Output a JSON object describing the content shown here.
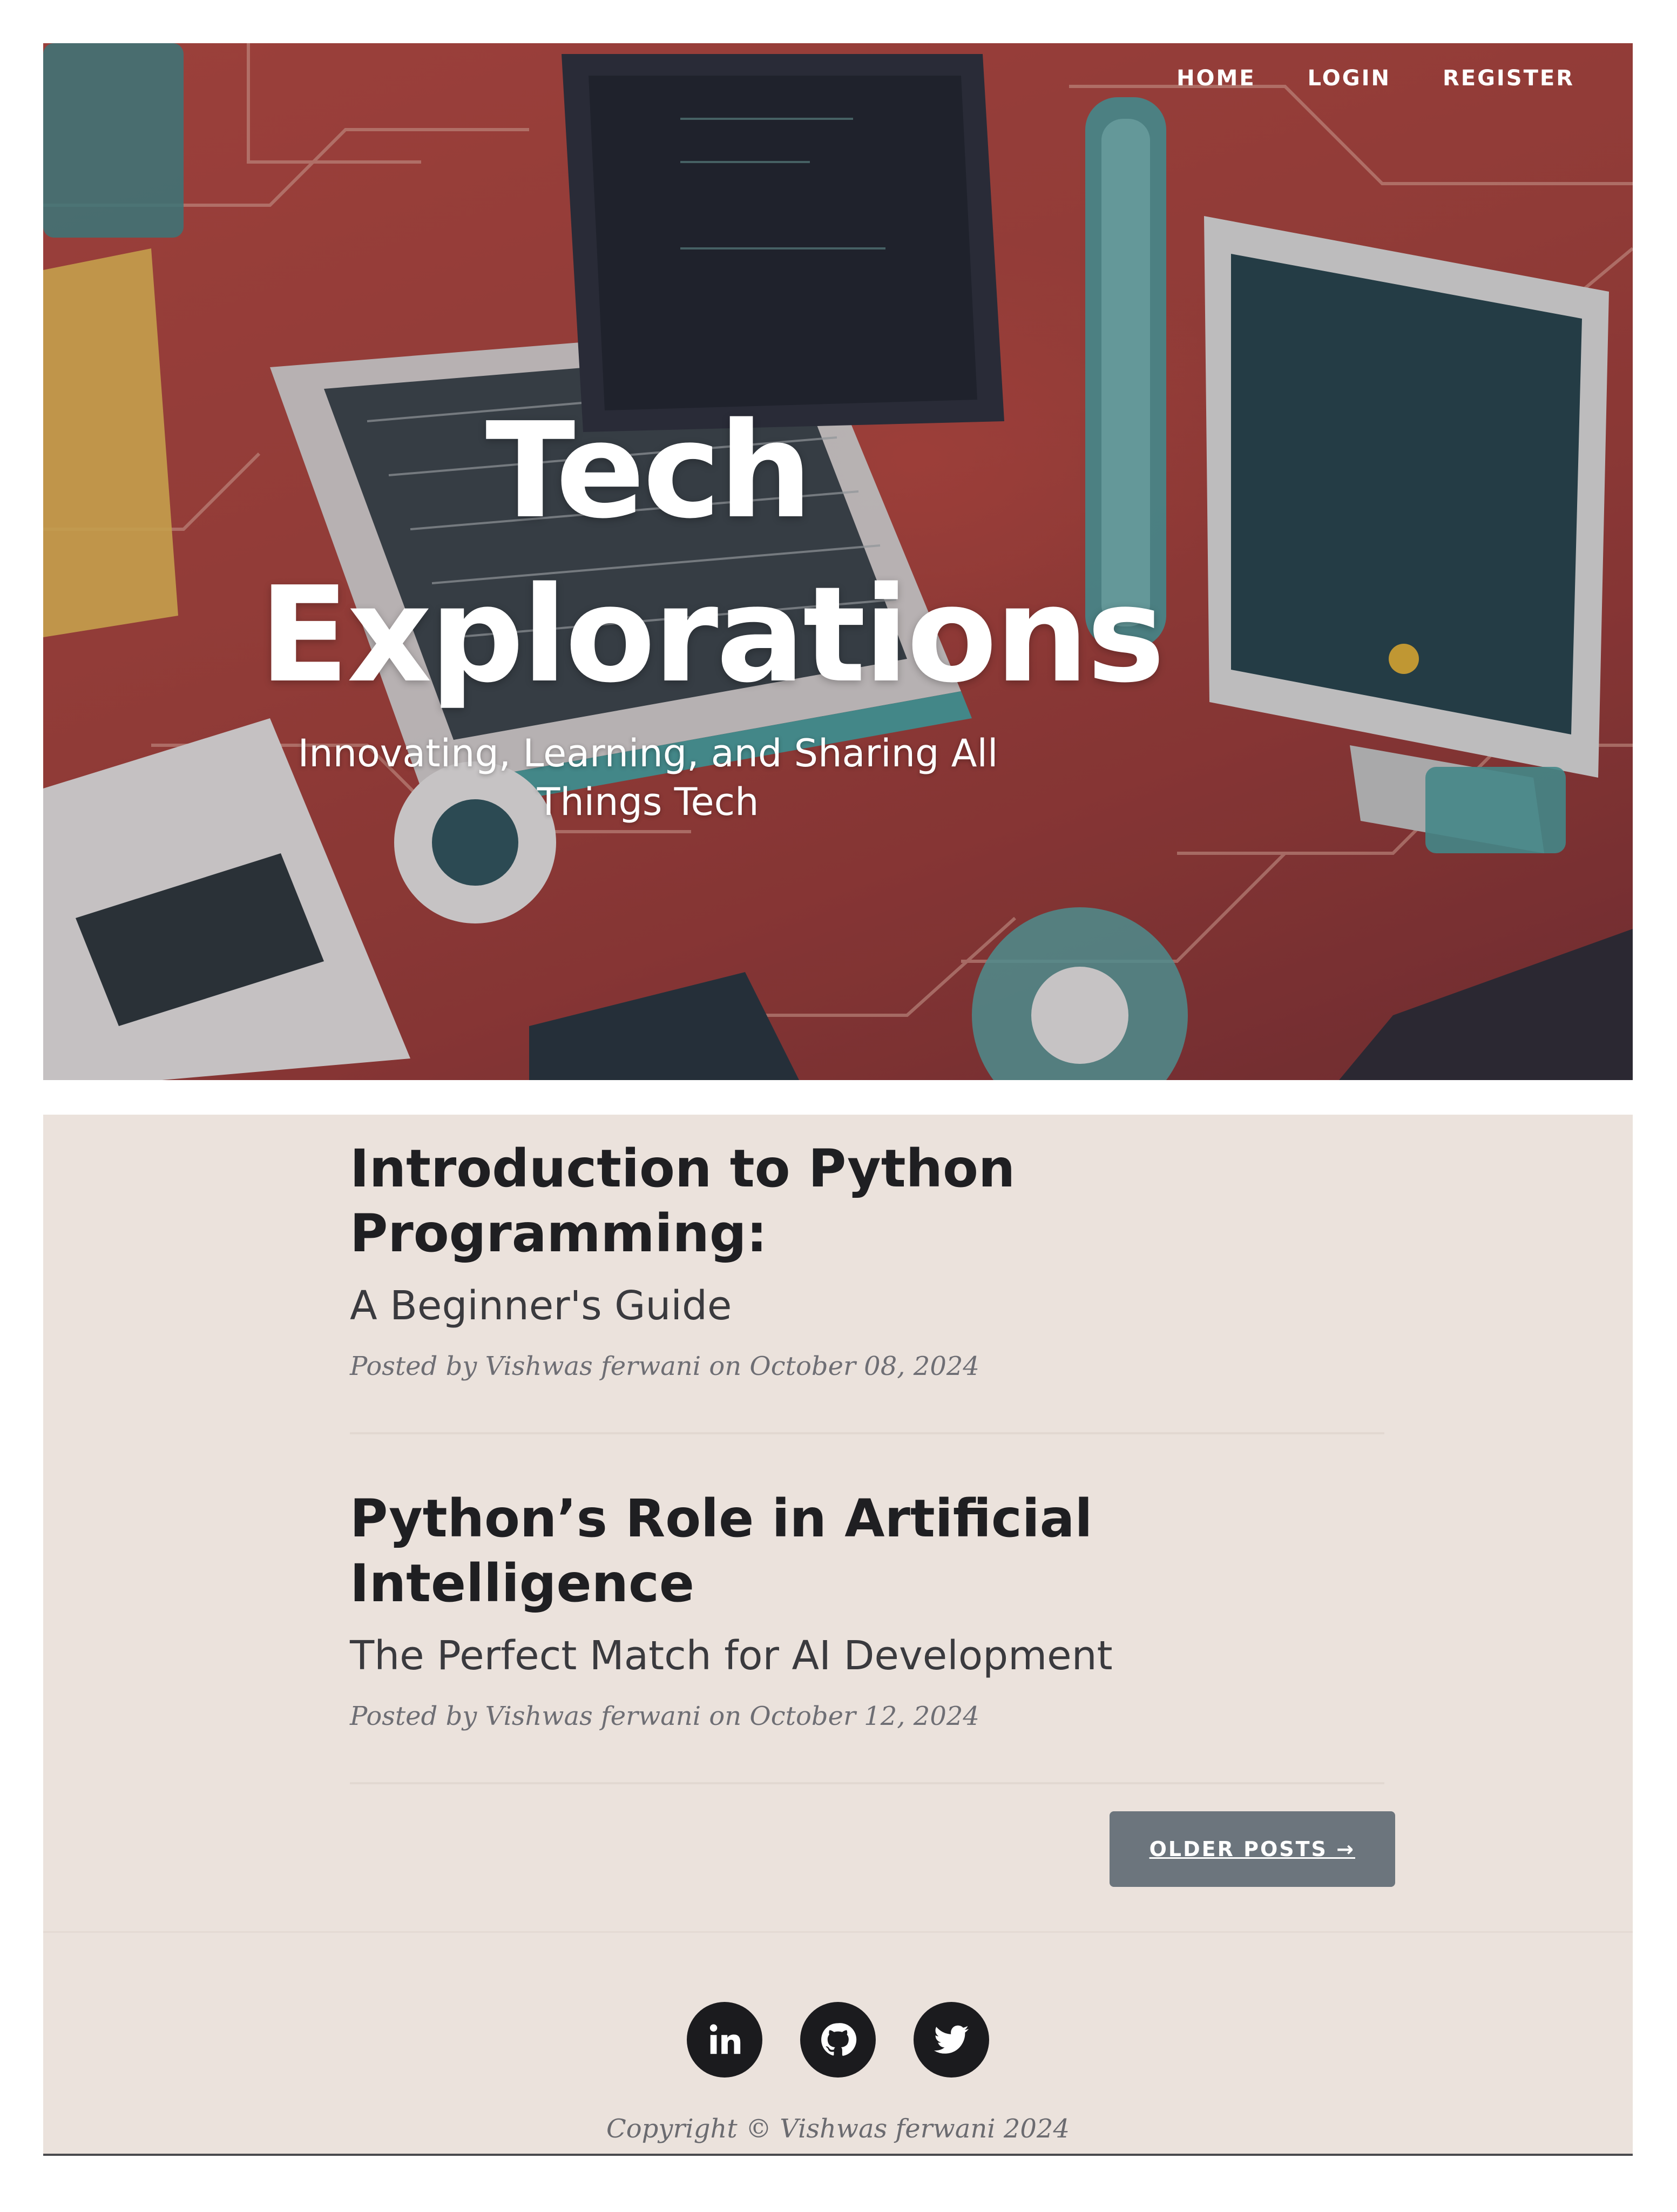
{
  "nav": {
    "items": [
      {
        "label": "Home"
      },
      {
        "label": "Login"
      },
      {
        "label": "Register"
      }
    ]
  },
  "hero": {
    "title_line1": "Tech",
    "title_line2": "Explorations",
    "subtitle": "Innovating, Learning, and Sharing All Things Tech"
  },
  "posts": [
    {
      "title": "Introduction to Python Programming:",
      "subtitle": "A Beginner's Guide",
      "meta_prefix": "Posted by",
      "author": "Vishwas ferwani",
      "meta_on": "on",
      "date": "October 08, 2024"
    },
    {
      "title": "Python’s Role in Artificial Intelligence",
      "subtitle": "The Perfect Match for AI Development",
      "meta_prefix": "Posted by",
      "author": "Vishwas ferwani",
      "meta_on": "on",
      "date": "October 12, 2024"
    }
  ],
  "pager": {
    "older_label": "Older Posts →"
  },
  "footer": {
    "social": [
      {
        "icon": "linkedin-icon"
      },
      {
        "icon": "github-icon"
      },
      {
        "icon": "twitter-icon"
      }
    ],
    "copyright": "Copyright © Vishwas ferwani 2024"
  }
}
